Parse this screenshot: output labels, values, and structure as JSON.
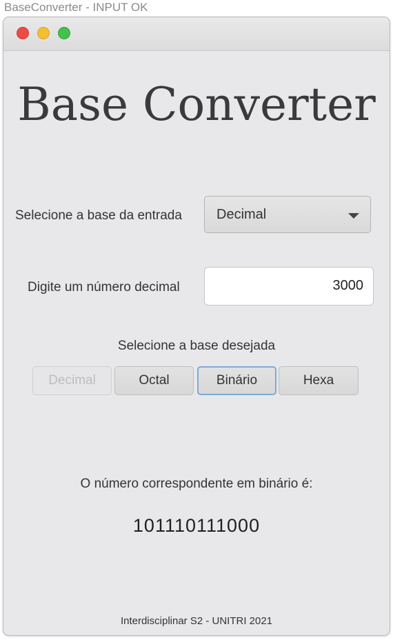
{
  "outer_title": "BaseConverter - INPUT OK",
  "app": {
    "title": "Base Converter",
    "input_base_label": "Selecione a base da entrada",
    "input_base_selected": "Decimal",
    "number_label": "Digite um número decimal",
    "number_value": "3000",
    "target_base_label": "Selecione a base desejada",
    "buttons": [
      "Decimal",
      "Octal",
      "Binário",
      "Hexa"
    ],
    "result_label": "O número correspondente em binário é:",
    "result_value": "101110111000",
    "footer": "Interdisciplinar S2 - UNITRI 2021"
  }
}
